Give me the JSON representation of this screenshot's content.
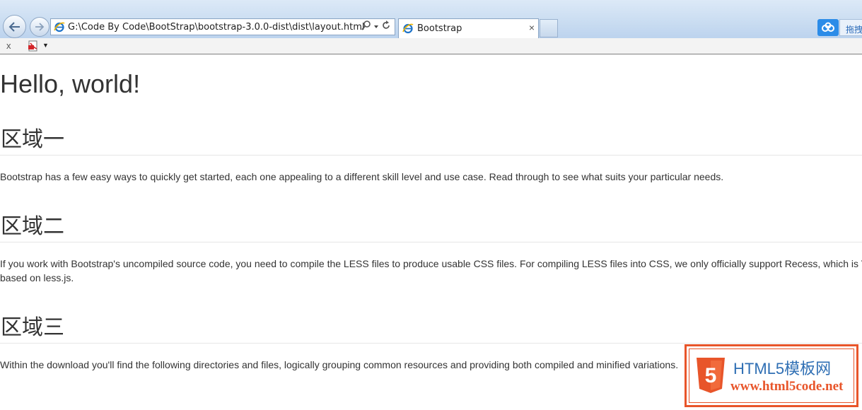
{
  "browser": {
    "address": "G:\\Code By Code\\BootStrap\\bootstrap-3.0.0-dist\\dist\\layout.html",
    "tab_title": "Bootstrap",
    "tab_close": "×",
    "side_button_label": "拖拽",
    "cmd_close": "x"
  },
  "page": {
    "heading": "Hello, world!",
    "sections": [
      {
        "title": "区域一",
        "text": "Bootstrap has a few easy ways to quickly get started, each one appealing to a different skill level and use case. Read through to see what suits your particular needs."
      },
      {
        "title": "区域二",
        "text_line1": "If you work with Bootstrap's uncompiled source code, you need to compile the LESS files to produce usable CSS files. For compiling LESS files into CSS, we only officially support Recess, which is Twitter's CSS hinter",
        "text_line2": "based on less.js."
      },
      {
        "title": "区域三",
        "text": "Within the download you'll find the following directories and files, logically grouping common resources and providing both compiled and minified variations."
      }
    ]
  },
  "watermark": {
    "title": "HTML5模板网",
    "url": "www.html5code.net",
    "badge": "5"
  }
}
